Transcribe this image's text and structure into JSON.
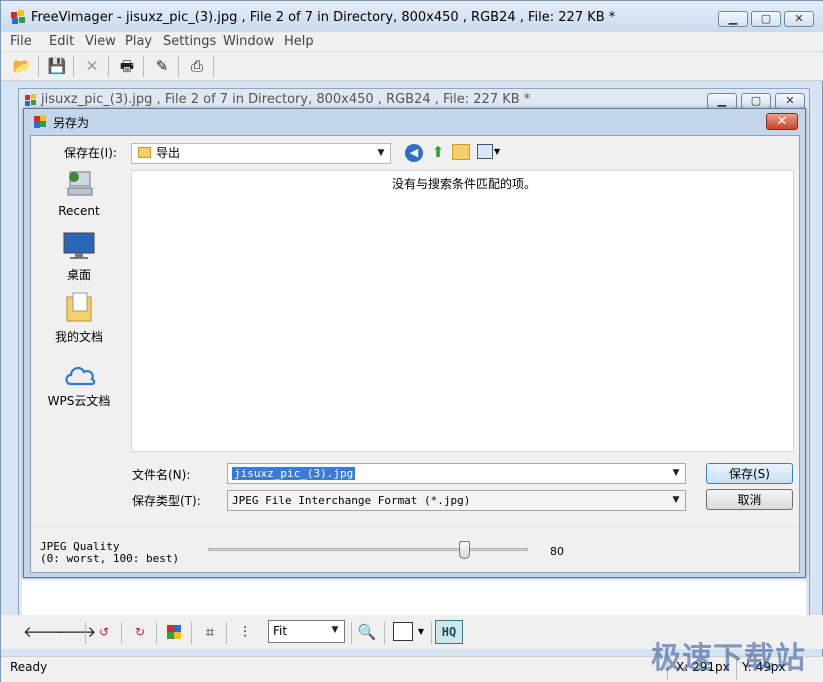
{
  "app": {
    "title": "FreeVimager - jisuxz_pic_(3).jpg , File 2 of 7 in Directory, 800x450 , RGB24 , File: 227 KB *",
    "child_title": "jisuxz_pic_(3).jpg , File 2 of 7 in Directory, 800x450 , RGB24 , File: 227 KB *"
  },
  "menu": [
    "File",
    "Edit",
    "View",
    "Play",
    "Settings",
    "Window",
    "Help"
  ],
  "dialog": {
    "title": "另存为",
    "close_glyph": "✕",
    "save_in_label": "保存在(I):",
    "current_folder": "导出",
    "empty_message": "没有与搜索条件匹配的项。",
    "places": [
      "Recent",
      "桌面",
      "我的文档",
      "WPS云文档"
    ],
    "filename_label": "文件名(N):",
    "filename_value": "jisuxz_pic_(3).jpg",
    "filetype_label": "保存类型(T):",
    "filetype_value": "JPEG File Interchange Format (*.jpg)",
    "save_button": "保存(S)",
    "cancel_button": "取消",
    "quality_label_1": "JPEG Quality",
    "quality_label_2": "(0: worst, 100: best)",
    "quality_value": "80",
    "quality_level": 80
  },
  "bottom_toolbar": {
    "zoom_value": "Fit",
    "hq_label": "HQ"
  },
  "status": {
    "text": "Ready",
    "x_readout": "X: 291px",
    "y_readout": "Y: 49px"
  },
  "watermark": "极速下载站"
}
